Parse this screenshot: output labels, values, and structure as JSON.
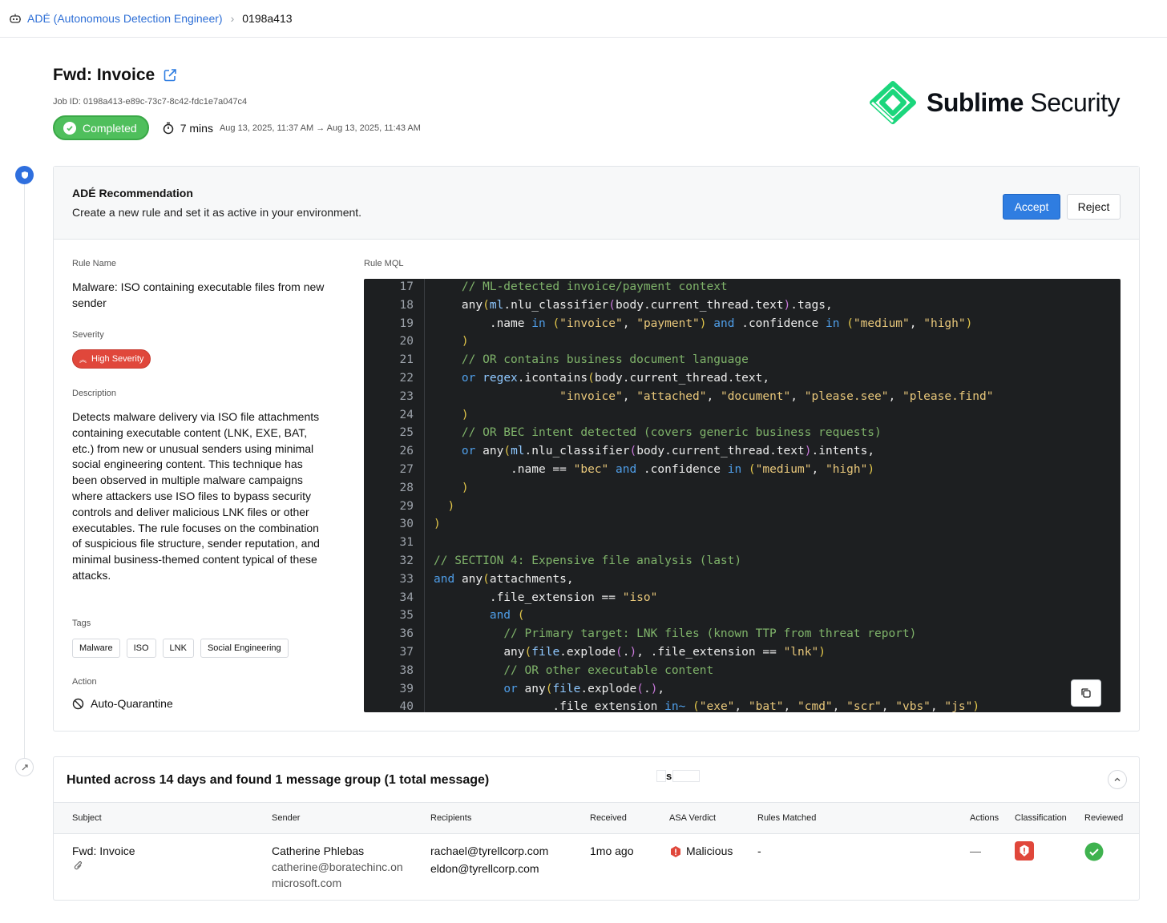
{
  "breadcrumb": {
    "app_link": "ADÉ (Autonomous Detection Engineer)",
    "current": "0198a413"
  },
  "header": {
    "title": "Fwd: Invoice",
    "job_id": "Job ID: 0198a413-e89c-73c7-8c42-fdc1e7a047c4",
    "status": "Completed",
    "duration": "7 mins",
    "time_range": "Aug 13, 2025, 11:37 AM → Aug 13, 2025, 11:43 AM"
  },
  "logo": {
    "bold": "Sublime",
    "regular": "Security",
    "color": "#1bd67c"
  },
  "recommendation": {
    "title": "ADÉ Recommendation",
    "subtitle": "Create a new rule and set it as active in your environment.",
    "accept_label": "Accept",
    "reject_label": "Reject"
  },
  "rule": {
    "name_label": "Rule Name",
    "name": "Malware: ISO containing executable files from new sender",
    "severity_label": "Severity",
    "severity": "High Severity",
    "description_label": "Description",
    "description": "Detects malware delivery via ISO file attachments containing executable content (LNK, EXE, BAT, etc.) from new or unusual senders using minimal social engineering content. This technique has been observed in multiple malware campaigns where attackers use ISO files to bypass security controls and deliver malicious LNK files or other executables. The rule focuses on the combination of suspicious file structure, sender reputation, and minimal business-themed content typical of these attacks.",
    "tags_label": "Tags",
    "tags": [
      "Malware",
      "ISO",
      "LNK",
      "Social Engineering"
    ],
    "action_label": "Action",
    "action": "Auto-Quarantine",
    "mql_label": "Rule MQL"
  },
  "code_lines": [
    {
      "n": "17",
      "t": "    // ML-detected invoice/payment context"
    },
    {
      "n": "18",
      "t": "    any(ml.nlu_classifier(body.current_thread.text).tags,"
    },
    {
      "n": "19",
      "t": "        .name in (\"invoice\", \"payment\") and .confidence in (\"medium\", \"high\")"
    },
    {
      "n": "20",
      "t": "    )"
    },
    {
      "n": "21",
      "t": "    // OR contains business document language"
    },
    {
      "n": "22",
      "t": "    or regex.icontains(body.current_thread.text,"
    },
    {
      "n": "23",
      "t": "                  \"invoice\", \"attached\", \"document\", \"please.see\", \"please.find\""
    },
    {
      "n": "24",
      "t": "    )"
    },
    {
      "n": "25",
      "t": "    // OR BEC intent detected (covers generic business requests)"
    },
    {
      "n": "26",
      "t": "    or any(ml.nlu_classifier(body.current_thread.text).intents,"
    },
    {
      "n": "27",
      "t": "           .name == \"bec\" and .confidence in (\"medium\", \"high\")"
    },
    {
      "n": "28",
      "t": "    )"
    },
    {
      "n": "29",
      "t": "  )"
    },
    {
      "n": "30",
      "t": ")"
    },
    {
      "n": "31",
      "t": ""
    },
    {
      "n": "32",
      "t": "// SECTION 4: Expensive file analysis (last)"
    },
    {
      "n": "33",
      "t": "and any(attachments,"
    },
    {
      "n": "34",
      "t": "        .file_extension == \"iso\""
    },
    {
      "n": "35",
      "t": "        and ("
    },
    {
      "n": "36",
      "t": "          // Primary target: LNK files (known TTP from threat report)"
    },
    {
      "n": "37",
      "t": "          any(file.explode(.), .file_extension == \"lnk\")"
    },
    {
      "n": "38",
      "t": "          // OR other executable content"
    },
    {
      "n": "39",
      "t": "          or any(file.explode(.),"
    },
    {
      "n": "40",
      "t": "                 .file_extension in~ (\"exe\", \"bat\", \"cmd\", \"scr\", \"vbs\", \"js\")"
    }
  ],
  "hunt": {
    "title": "Hunted across 14 days and found 1 message group (1 total message)",
    "stray_text": "s",
    "columns": [
      "Subject",
      "Sender",
      "Recipients",
      "Received",
      "ASA Verdict",
      "Rules Matched",
      "Actions",
      "Classification",
      "Reviewed"
    ],
    "row": {
      "subject": "Fwd: Invoice",
      "sender_name": "Catherine Phlebas",
      "sender_email_1": "catherine@boratechinc.on",
      "sender_email_2": "microsoft.com",
      "recipient_1": "rachael@tyrellcorp.com",
      "recipient_2": "eldon@tyrellcorp.com",
      "received": "1mo ago",
      "verdict": "Malicious",
      "rules_matched": "-",
      "actions": "—"
    }
  },
  "colors": {
    "accent": "#2f7de1",
    "completed": "#4fbf5c",
    "severity_high": "#e0473b",
    "malicious": "#e0473b",
    "reviewed": "#3fb24f"
  }
}
